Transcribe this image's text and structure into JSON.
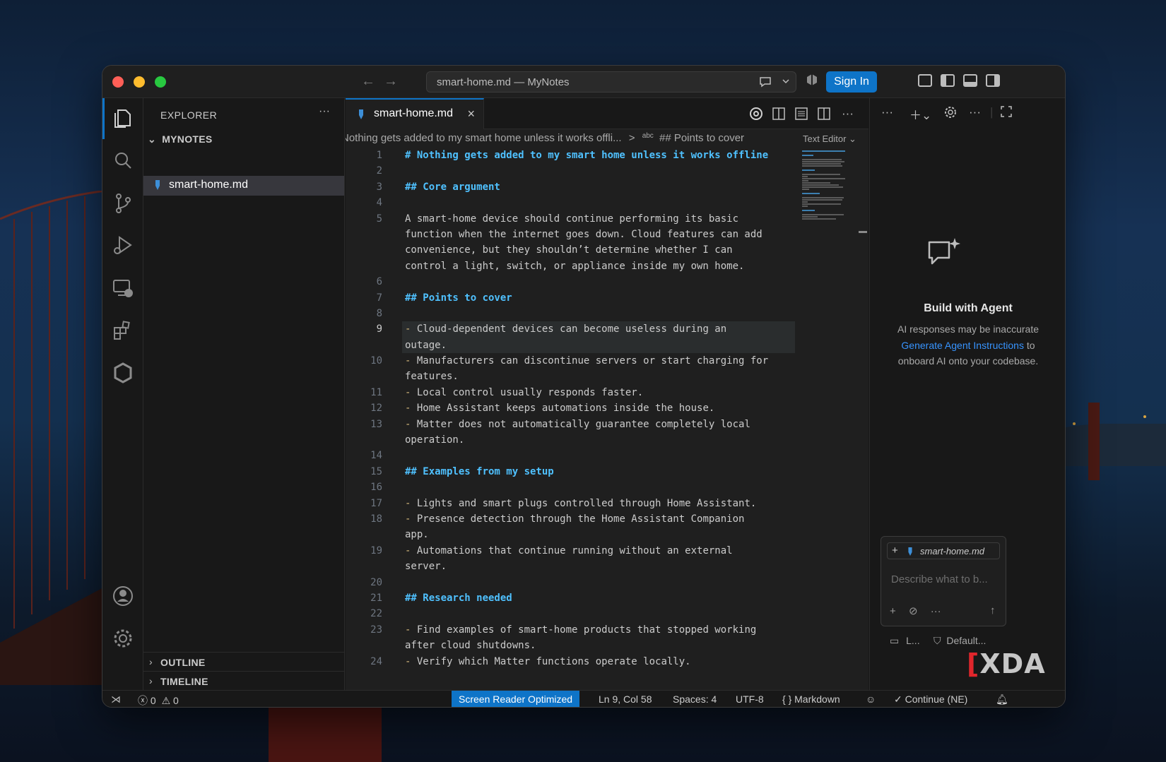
{
  "titlebar": {
    "search_text": "smart-home.md — MyNotes",
    "sign_in": "Sign In"
  },
  "sidebar": {
    "title": "EXPLORER",
    "more": "···",
    "folder": "MYNOTES",
    "file": "smart-home.md",
    "outline": "OUTLINE",
    "timeline": "TIMELINE"
  },
  "editor": {
    "tab_label": "smart-home.md",
    "breadcrumb_part1": "Nothing gets added to my smart home unless it works offli...",
    "breadcrumb_sep": ">",
    "breadcrumb_abc": "abc",
    "breadcrumb_part2": "## Points to cover",
    "text_editor_label": "Text Editor",
    "lines": [
      {
        "n": "1",
        "t": "# Nothing gets added to my smart home unless it works offline",
        "k": "h"
      },
      {
        "n": "2",
        "t": "",
        "k": ""
      },
      {
        "n": "3",
        "t": "## Core argument",
        "k": "h"
      },
      {
        "n": "4",
        "t": "",
        "k": ""
      },
      {
        "n": "5",
        "t": "A smart-home device should continue performing its basic",
        "k": ""
      },
      {
        "n": "",
        "t": "function when the internet goes down. Cloud features can add",
        "k": ""
      },
      {
        "n": "",
        "t": "convenience, but they shouldn’t determine whether I can",
        "k": ""
      },
      {
        "n": "",
        "t": "control a light, switch, or appliance inside my own home.",
        "k": ""
      },
      {
        "n": "6",
        "t": "",
        "k": ""
      },
      {
        "n": "7",
        "t": "## Points to cover",
        "k": "h"
      },
      {
        "n": "8",
        "t": "",
        "k": ""
      },
      {
        "n": "9",
        "t": "- Cloud-dependent devices can become useless during an",
        "k": "d",
        "cur": true
      },
      {
        "n": "",
        "t": "outage.",
        "k": "",
        "cur2": true
      },
      {
        "n": "10",
        "t": "- Manufacturers can discontinue servers or start charging for",
        "k": "d"
      },
      {
        "n": "",
        "t": "features.",
        "k": ""
      },
      {
        "n": "11",
        "t": "- Local control usually responds faster.",
        "k": "d"
      },
      {
        "n": "12",
        "t": "- Home Assistant keeps automations inside the house.",
        "k": "d"
      },
      {
        "n": "13",
        "t": "- Matter does not automatically guarantee completely local",
        "k": "d"
      },
      {
        "n": "",
        "t": "operation.",
        "k": ""
      },
      {
        "n": "14",
        "t": "",
        "k": ""
      },
      {
        "n": "15",
        "t": "## Examples from my setup",
        "k": "h"
      },
      {
        "n": "16",
        "t": "",
        "k": ""
      },
      {
        "n": "17",
        "t": "- Lights and smart plugs controlled through Home Assistant.",
        "k": "d"
      },
      {
        "n": "18",
        "t": "- Presence detection through the Home Assistant Companion",
        "k": "d"
      },
      {
        "n": "",
        "t": "app.",
        "k": ""
      },
      {
        "n": "19",
        "t": "- Automations that continue running without an external",
        "k": "d"
      },
      {
        "n": "",
        "t": "server.",
        "k": ""
      },
      {
        "n": "20",
        "t": "",
        "k": ""
      },
      {
        "n": "21",
        "t": "## Research needed",
        "k": "h"
      },
      {
        "n": "22",
        "t": "",
        "k": ""
      },
      {
        "n": "23",
        "t": "- Find examples of smart-home products that stopped working",
        "k": "d"
      },
      {
        "n": "",
        "t": "after cloud shutdowns.",
        "k": ""
      },
      {
        "n": "24",
        "t": "- Verify which Matter functions operate locally.",
        "k": "d"
      }
    ]
  },
  "agent": {
    "title": "Build with Agent",
    "desc1": "AI responses may be inaccurate",
    "link": "Generate Agent Instructions",
    "desc2": "to onboard AI onto your codebase.",
    "chip": "smart-home.md",
    "placeholder": "Describe what to b...",
    "footer_left": "L...",
    "footer_right": "Default..."
  },
  "status": {
    "errors": "0",
    "warnings": "0",
    "screen_reader": "Screen Reader Optimized",
    "position": "Ln 9, Col 58",
    "spaces": "Spaces: 4",
    "encoding": "UTF-8",
    "language": "Markdown",
    "continue": "Continue (NE)"
  },
  "watermark": "XDA",
  "colors": {
    "accent": "#0e74c8",
    "heading": "#4fc1ff",
    "link": "#3794ff"
  }
}
